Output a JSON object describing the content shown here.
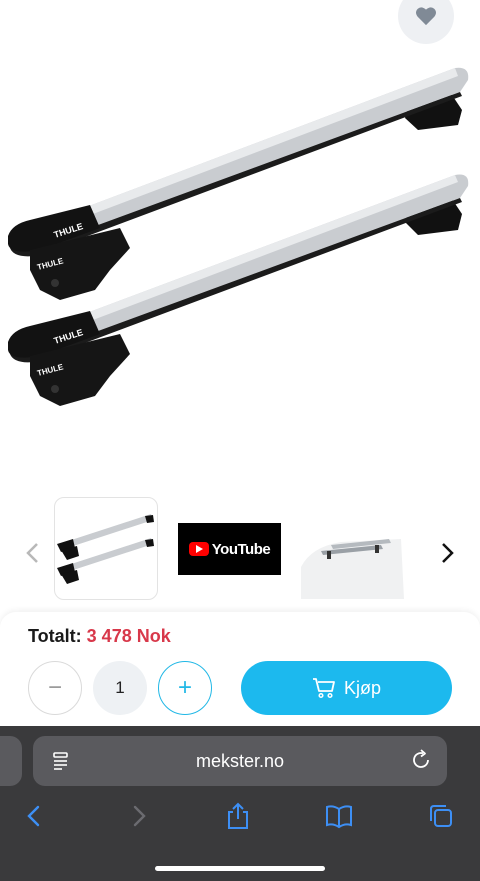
{
  "product": {
    "brand_label": "THULE"
  },
  "favorite": {
    "icon": "heart-icon"
  },
  "gallery": {
    "video_label": "YouTube",
    "prev_icon": "chevron-left-icon",
    "next_icon": "chevron-right-icon"
  },
  "cart": {
    "total_label": "Totalt:",
    "total_value": "3 478 Nok",
    "quantity": "1",
    "minus_label": "−",
    "plus_label": "+",
    "buy_label": "Kjøp"
  },
  "browser": {
    "url": "mekster.no"
  },
  "colors": {
    "accent": "#1cb9ee",
    "price": "#d8384a",
    "chrome": "#3a3a3c",
    "toolbar_icon": "#3d8ff5"
  }
}
